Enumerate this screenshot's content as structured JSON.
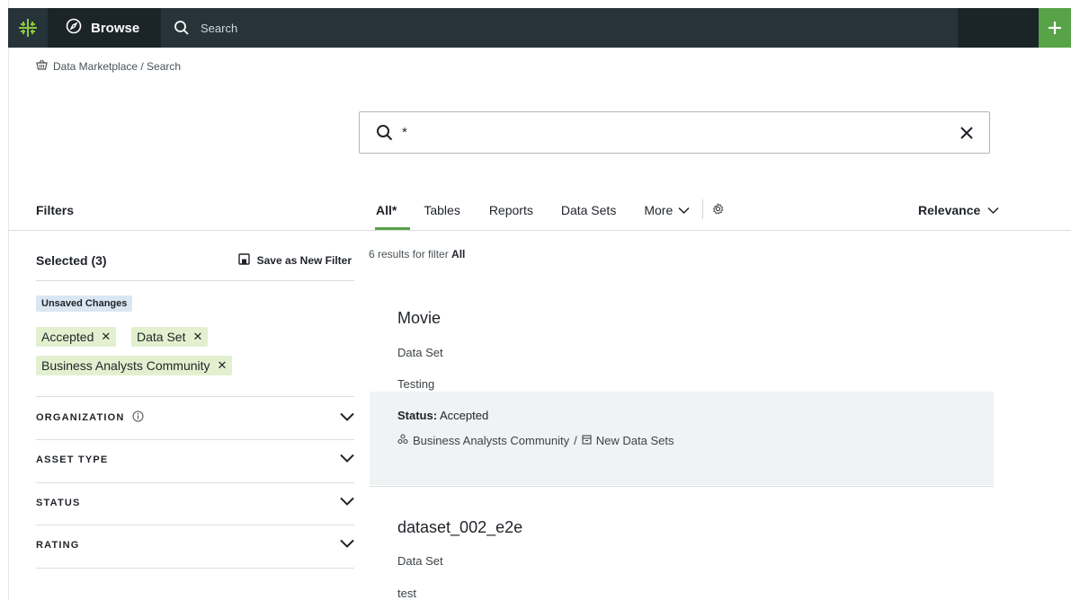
{
  "topbar": {
    "browse_label": "Browse",
    "search_placeholder": "Search",
    "logo_icon": "snowflake-logo-icon",
    "add_icon": "plus-icon",
    "accent": "#58a247"
  },
  "breadcrumb": {
    "text": "Data Marketplace / Search",
    "icon": "basket-icon"
  },
  "search": {
    "value": "*"
  },
  "filters": {
    "title": "Filters",
    "selected_label": "Selected (3)",
    "save_label": "Save as New Filter",
    "unsaved_badge": "Unsaved Changes",
    "chips": [
      "Accepted",
      "Data Set",
      "Business Analysts Community"
    ],
    "facets": [
      "ORGANIZATION",
      "ASSET TYPE",
      "STATUS",
      "RATING"
    ]
  },
  "tabs": {
    "items": [
      "All*",
      "Tables",
      "Reports",
      "Data Sets"
    ],
    "more_label": "More",
    "sort_label": "Relevance"
  },
  "results": {
    "count_prefix": "6 results for filter",
    "count_filter": "All",
    "items": [
      {
        "title": "Movie",
        "type": "Data Set",
        "description": "Testing",
        "status_label": "Status:",
        "status_value": "Accepted",
        "community": "Business Analysts Community",
        "separator": "/",
        "domain": "New Data Sets"
      },
      {
        "title": "dataset_002_e2e",
        "type": "Data Set",
        "description": "test"
      }
    ]
  }
}
